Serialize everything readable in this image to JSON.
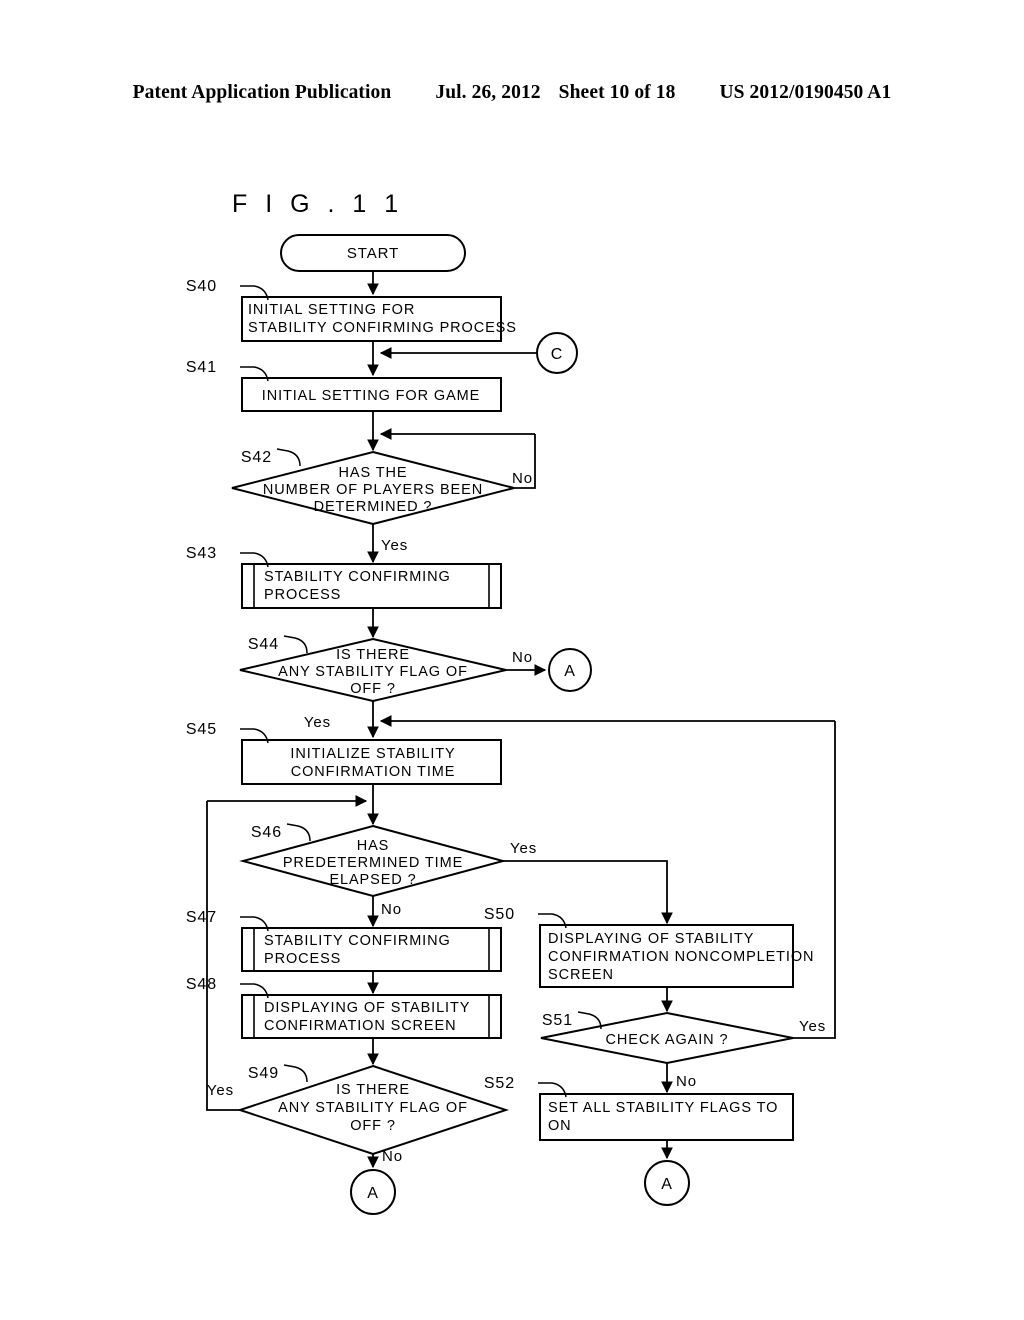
{
  "header": {
    "publication": "Patent Application Publication",
    "date": "Jul. 26, 2012",
    "sheet": "Sheet 10 of 18",
    "patent_number": "US 2012/0190450 A1"
  },
  "figure": {
    "label": "F I G .   1 1"
  },
  "flowchart": {
    "type": "flowchart",
    "terminators": {
      "start": "START"
    },
    "connectors": [
      {
        "id": "conn-c-right",
        "label": "C"
      },
      {
        "id": "conn-a-s44",
        "label": "A"
      },
      {
        "id": "conn-a-bottom-left",
        "label": "A"
      },
      {
        "id": "conn-a-bottom-right",
        "label": "A"
      }
    ],
    "nodes": [
      {
        "id": "S40",
        "step": "S40",
        "shape": "process",
        "lines": [
          "INITIAL SETTING FOR",
          "STABILITY CONFIRMING PROCESS"
        ]
      },
      {
        "id": "S41",
        "step": "S41",
        "shape": "process",
        "lines": [
          "INITIAL SETTING FOR GAME"
        ]
      },
      {
        "id": "S42",
        "step": "S42",
        "shape": "decision",
        "lines": [
          "HAS THE",
          "NUMBER OF PLAYERS BEEN",
          "DETERMINED ?"
        ]
      },
      {
        "id": "S43",
        "step": "S43",
        "shape": "predefined-process",
        "lines": [
          "STABILITY CONFIRMING",
          "PROCESS"
        ]
      },
      {
        "id": "S44",
        "step": "S44",
        "shape": "decision",
        "lines": [
          "IS THERE",
          "ANY STABILITY FLAG OF",
          "OFF ?"
        ]
      },
      {
        "id": "S45",
        "step": "S45",
        "shape": "process",
        "lines": [
          "INITIALIZE STABILITY",
          "CONFIRMATION TIME"
        ]
      },
      {
        "id": "S46",
        "step": "S46",
        "shape": "decision",
        "lines": [
          "HAS",
          "PREDETERMINED TIME",
          "ELAPSED ?"
        ]
      },
      {
        "id": "S47",
        "step": "S47",
        "shape": "predefined-process",
        "lines": [
          "STABILITY CONFIRMING",
          "PROCESS"
        ]
      },
      {
        "id": "S48",
        "step": "S48",
        "shape": "predefined-process",
        "lines": [
          "DISPLAYING OF STABILITY",
          "CONFIRMATION SCREEN"
        ]
      },
      {
        "id": "S49",
        "step": "S49",
        "shape": "decision",
        "lines": [
          "IS THERE",
          "ANY STABILITY FLAG OF",
          "OFF ?"
        ]
      },
      {
        "id": "S50",
        "step": "S50",
        "shape": "process",
        "lines": [
          "DISPLAYING OF STABILITY",
          "CONFIRMATION NONCOMPLETION",
          "SCREEN"
        ]
      },
      {
        "id": "S51",
        "step": "S51",
        "shape": "decision",
        "lines": [
          "CHECK AGAIN ?"
        ]
      },
      {
        "id": "S52",
        "step": "S52",
        "shape": "process",
        "lines": [
          "SET ALL STABILITY FLAGS TO",
          "ON"
        ]
      }
    ],
    "edge_labels": {
      "s42_no": "No",
      "s42_yes": "Yes",
      "s44_no": "No",
      "s44_yes": "Yes",
      "s46_yes": "Yes",
      "s46_no": "No",
      "s49_yes": "Yes",
      "s49_no": "No",
      "s51_yes": "Yes",
      "s51_no": "No"
    }
  },
  "colors": {
    "ink": "#000000",
    "paper": "#ffffff"
  }
}
